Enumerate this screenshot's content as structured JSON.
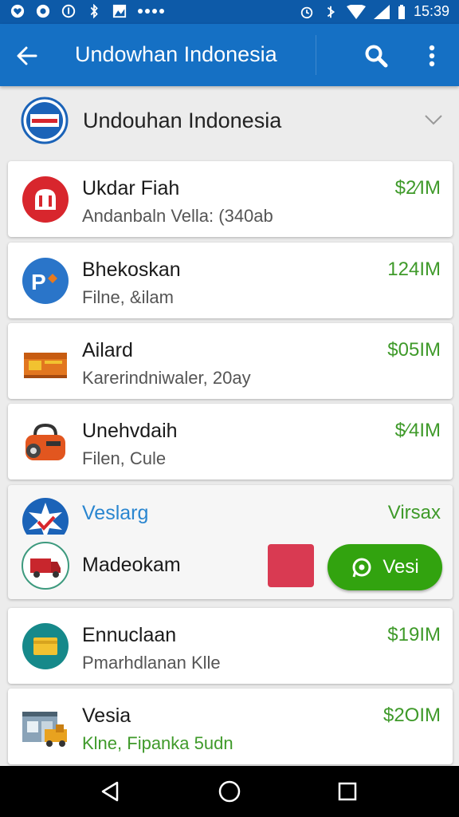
{
  "status_bar": {
    "time": "15:39",
    "icons_left": [
      "heart-icon",
      "message-icon",
      "info-icon",
      "bluetooth-icon",
      "photo-icon",
      "more-dots-icon"
    ],
    "icons_right": [
      "alarm-icon",
      "vibrate-icon",
      "wifi-icon",
      "signal-icon",
      "battery-icon"
    ]
  },
  "app_bar": {
    "title": "Undowhan Indonesia",
    "icons": [
      "back-arrow-icon",
      "search-icon",
      "overflow-menu-icon"
    ]
  },
  "section_header": {
    "title": "Undouhan Indonesia",
    "icon": "flag-logo-icon"
  },
  "items": [
    {
      "title": "Ukdar Fiah",
      "subtitle": "Andanbaln Vella: (340ab",
      "amount": "$2⁄IM",
      "icon": "red-app-icon"
    },
    {
      "title": "Bhekoskan",
      "subtitle": "Filne, &ilam",
      "amount": "124IM",
      "icon": "parking-icon"
    },
    {
      "title": "Ailard",
      "subtitle": "Karerindniwaler, 20ay",
      "amount": "$05IM",
      "icon": "box-icon"
    },
    {
      "title": "Unehvdaih",
      "subtitle": "Filen, Cule",
      "amount": "$⁄4IM",
      "icon": "bag-icon"
    }
  ],
  "special": {
    "title": "Veslarg",
    "amount": "Virsax",
    "name": "Madeokam",
    "tag_text": "",
    "button_label": "Vesi",
    "icons": [
      "badge-icon",
      "truck-icon",
      "whatsapp-icon"
    ]
  },
  "items2": [
    {
      "title": "Ennuclaan",
      "subtitle": "Pmarhdlanan Klle",
      "amount": "$19IM",
      "icon": "card-icon"
    },
    {
      "title": "Vesia",
      "subtitle": "Klne, Fipanka 5udn",
      "amount": "$2OIM",
      "icon": "shop-truck-icon"
    }
  ],
  "colors": {
    "status_bar": "#0d5aa8",
    "app_bar": "#1570c4",
    "amount_green": "#3f9a2a",
    "button_green": "#32a30f",
    "link_blue": "#2a86d0"
  },
  "nav_bar": {
    "icons": [
      "nav-back-icon",
      "nav-home-icon",
      "nav-recents-icon"
    ]
  }
}
